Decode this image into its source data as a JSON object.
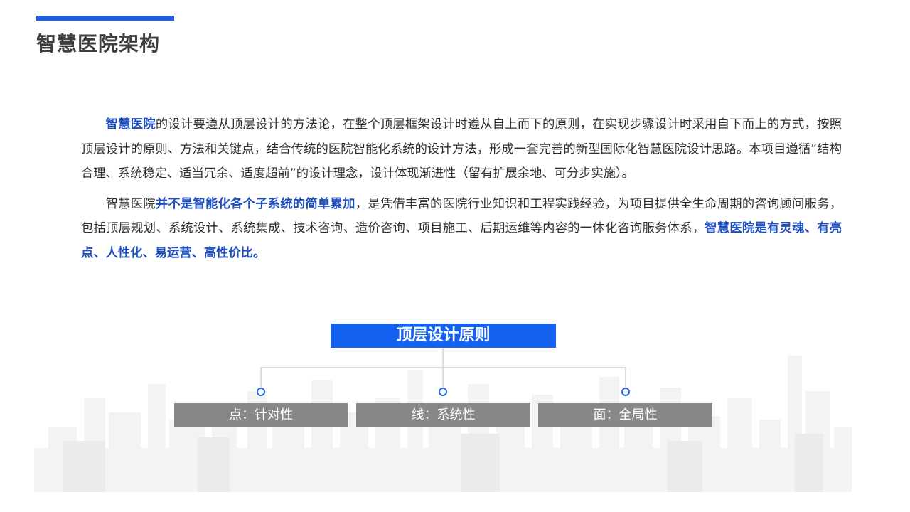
{
  "page": {
    "title": "智慧医院架构"
  },
  "paragraphs": [
    {
      "segments": [
        {
          "text": "智慧医院",
          "highlight": true
        },
        {
          "text": "的设计要遵从顶层设计的方法论，在整个顶层框架设计时遵从自上而下的原则，在实现步骤设计时采用自下而上的方式，按照顶层设计的原则、方法和关键点，结合传统的医院智能化系统的设计方法，形成一套完善的新型国际化智慧医院设计思路。本项目遵循“结构合理、系统稳定、适当冗余、适度超前”的设计理念，设计体现渐进性（留有扩展余地、可分步实施）。",
          "highlight": false
        }
      ]
    },
    {
      "segments": [
        {
          "text": "智慧医院",
          "highlight": false
        },
        {
          "text": "并不是智能化各个子系统的简单累加",
          "highlight": true
        },
        {
          "text": "，是凭借丰富的医院行业知识和工程实践经验，为项目提供全生命周期的咨询顾问服务，包括顶层规划、系统设计、系统集成、技术咨询、造价咨询、项目施工、后期运维等内容的一体化咨询服务体系，",
          "highlight": false
        },
        {
          "text": "智慧医院是有灵魂、有亮点、人性化、易运营、高性价比。",
          "highlight": true
        }
      ]
    }
  ],
  "diagram": {
    "root": "顶层设计原则",
    "nodes": [
      "点：针对性",
      "线：系统性",
      "面：全局性"
    ]
  },
  "colors": {
    "accent": "#1f5fe0",
    "root_fill": "#1662f0",
    "highlight_text": "#1f4fbf",
    "node_fill": "#888888"
  }
}
